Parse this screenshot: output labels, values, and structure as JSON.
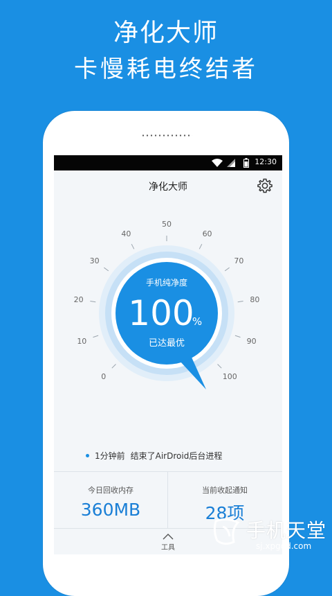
{
  "promo": {
    "title": "净化大师",
    "subtitle": "卡慢耗电终结者"
  },
  "statusbar": {
    "time": "12:30",
    "icons": [
      "wifi-icon",
      "signal-icon",
      "battery-icon"
    ]
  },
  "app": {
    "title": "净化大师",
    "settings_icon": "gear-icon"
  },
  "gauge": {
    "ticks": [
      "0",
      "10",
      "20",
      "30",
      "40",
      "50",
      "60",
      "70",
      "80",
      "90",
      "100"
    ],
    "label": "手机纯净度",
    "value": "100",
    "unit": "%",
    "status": "已达最优",
    "level": 100
  },
  "log": {
    "time": "1分钟前",
    "message": "结束了AirDroid后台进程"
  },
  "stats": {
    "left": {
      "label": "今日回收内存",
      "value": "360MB"
    },
    "right": {
      "label": "当前收起通知",
      "value": "28项"
    }
  },
  "toolbar": {
    "label": "工具",
    "icon": "chevron-up-icon"
  },
  "watermark": {
    "title": "手机天堂",
    "url": "sj.xpgod.com"
  },
  "colors": {
    "background": "#1a8fe3",
    "accent": "#1a8fe3",
    "screen": "#f3f6f9"
  }
}
